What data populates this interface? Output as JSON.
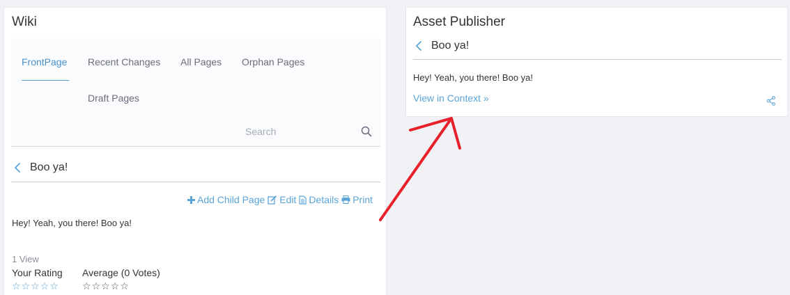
{
  "wiki": {
    "title": "Wiki",
    "tabs": [
      {
        "label": "FrontPage",
        "active": true
      },
      {
        "label": "Recent Changes",
        "active": false
      },
      {
        "label": "All Pages",
        "active": false
      },
      {
        "label": "Orphan Pages",
        "active": false
      },
      {
        "label": "Draft Pages",
        "active": false
      }
    ],
    "search": {
      "placeholder": "Search"
    },
    "page": {
      "title": "Boo ya!",
      "content": "Hey! Yeah, you there! Boo ya!",
      "actions": {
        "add_child": "Add Child Page",
        "edit": "Edit",
        "details": "Details",
        "print": "Print"
      },
      "views": "1 View",
      "your_rating_label": "Your Rating",
      "average_label": "Average (0 Votes)",
      "your_rating": 0,
      "average_rating": 0,
      "max_rating": 5
    }
  },
  "asset_publisher": {
    "title": "Asset Publisher",
    "entry_title": "Boo ya!",
    "content": "Hey! Yeah, you there! Boo ya!",
    "view_in_context": "View in Context »"
  },
  "colors": {
    "accent": "#5aa4d8",
    "arrow": "#e8202a"
  },
  "icons": [
    "back-icon",
    "search-icon",
    "plus-icon",
    "edit-icon",
    "details-icon",
    "print-icon",
    "star-icon",
    "share-icon"
  ]
}
